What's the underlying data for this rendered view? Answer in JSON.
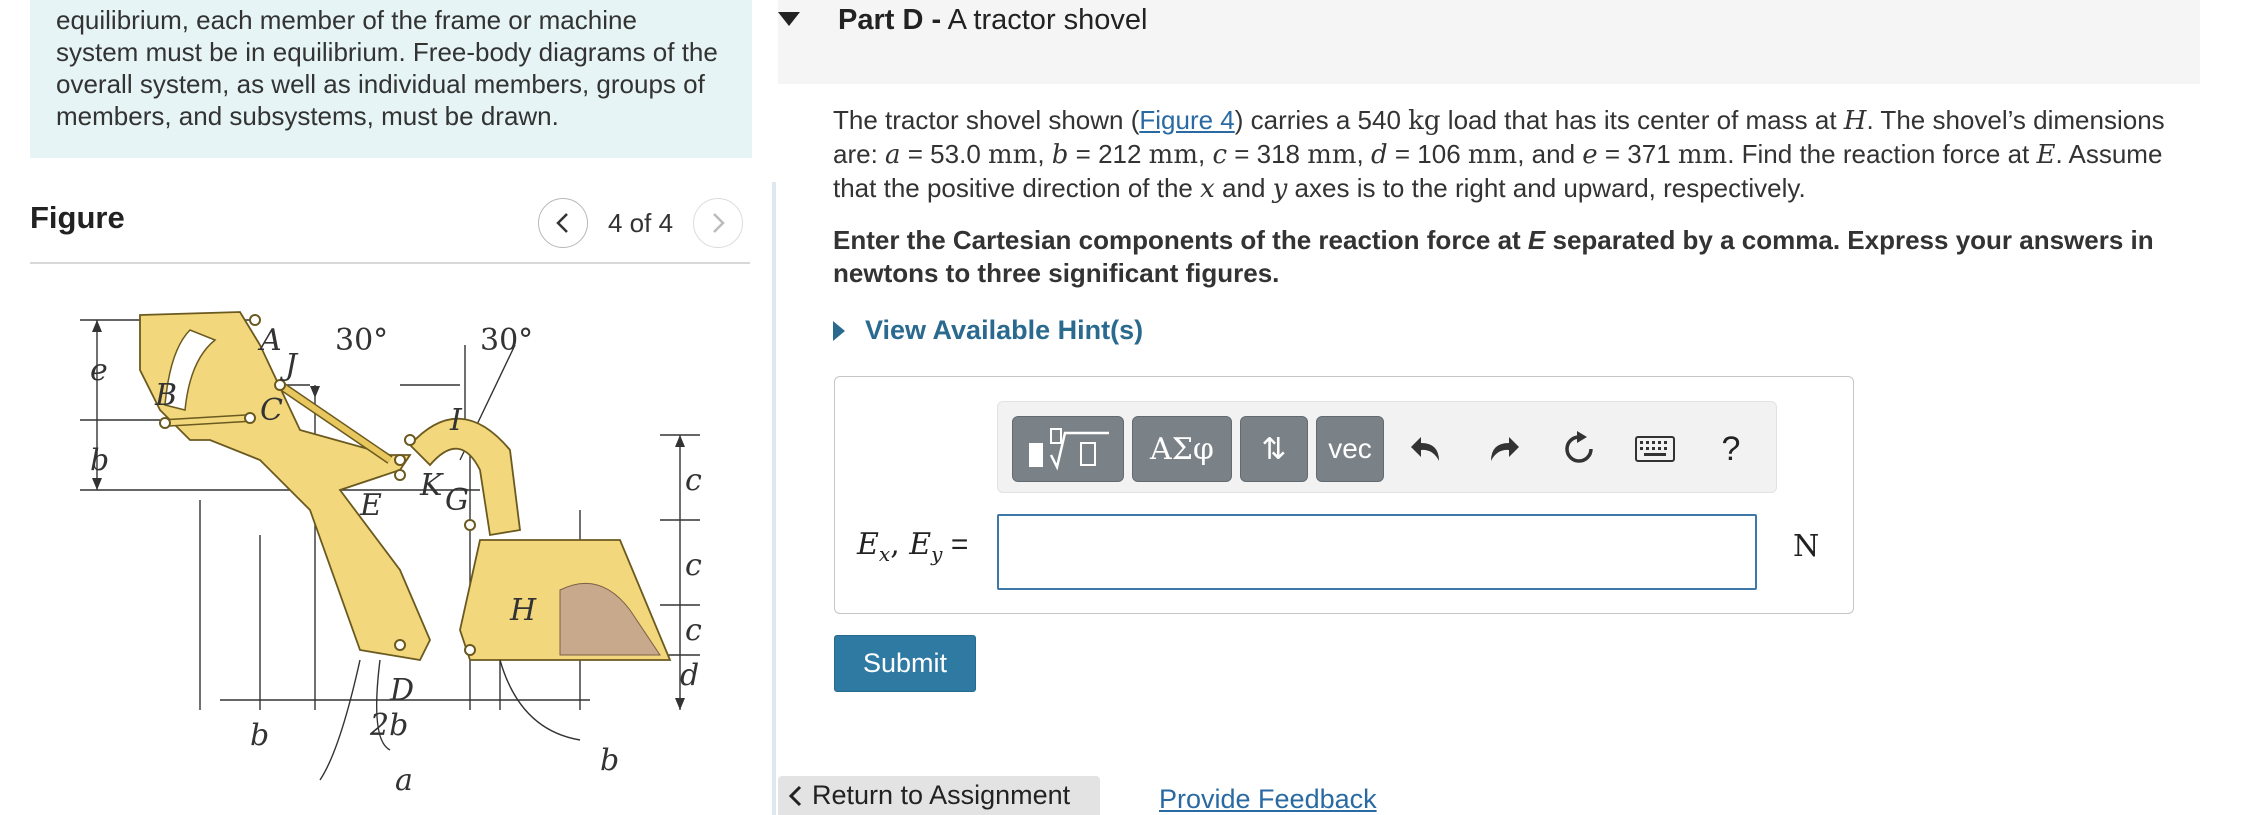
{
  "intro": {
    "text": "equilibrium, each member of the frame or machine system must be in equilibrium. Free-body diagrams of the overall system, as well as individual members, groups of members, and subsystems, must be drawn."
  },
  "figure": {
    "title": "Figure",
    "counter": "4 of 4",
    "labels": {
      "A": "A",
      "B": "B",
      "C": "C",
      "D": "D",
      "E": "E",
      "G": "G",
      "H": "H",
      "I": "I",
      "J": "J",
      "K": "K",
      "angle1": "30°",
      "angle2": "30°",
      "e": "e",
      "b1": "b",
      "b2": "b",
      "b3": "b",
      "two_b": "2b",
      "a": "a",
      "c1": "c",
      "c2": "c",
      "c3": "c",
      "d": "d"
    }
  },
  "part": {
    "prefix": "Part D -",
    "title": "A tractor shovel"
  },
  "problem": {
    "s1": "The tractor shovel shown (",
    "link": "Figure 4",
    "s2": ") carries a 540 ",
    "kg": "kg",
    "s3": " load that has its center of mass at ",
    "H": "H",
    "s4": ". The shovel’s dimensions are: ",
    "a_var": "a",
    "a_val": " = 53.0 ",
    "b_var": "b",
    "b_val": " = 212 ",
    "c_var": "c",
    "c_val": " = 318 ",
    "d_var": "d",
    "d_val": " = 106 ",
    "e_var": "e",
    "e_val": " = 371 ",
    "mm": "mm",
    "s5": ", and ",
    "s6": ". Find the reaction force at ",
    "E": "E",
    "s7": ". Assume that the positive direction of the ",
    "x": "x",
    "s8": " and ",
    "y": "y",
    "s9": " axes is to the right and upward, respectively."
  },
  "instruction": {
    "t1": "Enter the Cartesian components of the reaction force at ",
    "E": "E",
    "t2": " separated by a comma. Express your answers  in newtons to three significant figures."
  },
  "hint_label": "View Available Hint(s)",
  "toolbar": {
    "greek": "ΑΣφ",
    "updown": "⇅",
    "vec": "vec",
    "help": "?"
  },
  "answer": {
    "label_Ex": "E",
    "sub_x": "x",
    "label_Ey": "E",
    "sub_y": "y",
    "equals": " =",
    "value": "",
    "unit": "N"
  },
  "submit_label": "Submit",
  "return_label": "Return to Assignment",
  "feedback_label": "Provide Feedback"
}
